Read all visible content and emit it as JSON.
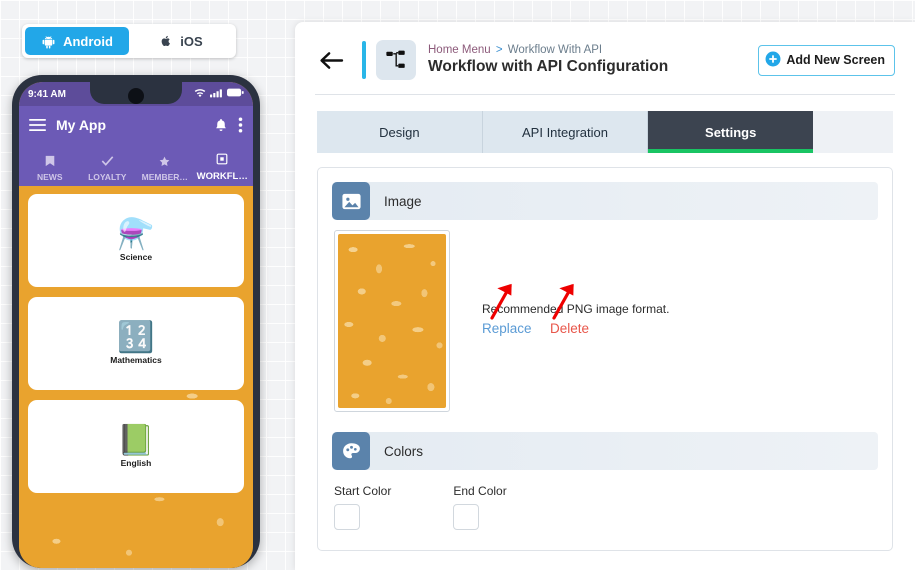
{
  "platform_switch": {
    "options": [
      {
        "label": "Android",
        "icon": "android-icon",
        "active": true
      },
      {
        "label": "iOS",
        "icon": "apple-icon",
        "active": false
      }
    ]
  },
  "phone": {
    "status_bar": {
      "time": "9:41 AM",
      "icons": [
        "wifi-icon",
        "cellular-signal-icon",
        "battery-icon"
      ]
    },
    "app_bar": {
      "menu_icon": "hamburger-menu-icon",
      "title": "My App",
      "notification_icon": "bell-icon",
      "overflow_icon": "more-vertical-icon"
    },
    "tabs": [
      {
        "label": "NEWS",
        "icon": "bookmark-icon",
        "active": false
      },
      {
        "label": "LOYALTY",
        "icon": "check-icon",
        "active": false
      },
      {
        "label": "MEMBER…",
        "icon": "star-icon",
        "active": false
      },
      {
        "label": "WORKFL…",
        "icon": "workflow-square-icon",
        "active": true
      }
    ],
    "cards": [
      {
        "label": "Science",
        "emoji": "⚗️"
      },
      {
        "label": "Mathematics",
        "emoji": "🔢"
      },
      {
        "label": "English",
        "emoji": "📗"
      }
    ],
    "background_color": "#e9a32e",
    "app_bar_color": "#6c5ab6"
  },
  "header": {
    "back_icon": "back-arrow-icon",
    "workflow_icon": "workflow-diagram-icon",
    "breadcrumb": {
      "parent": "Home Menu",
      "separator": ">",
      "current": "Workflow With API"
    },
    "title": "Workflow with API Configuration",
    "add_button": {
      "label": "Add New Screen",
      "icon": "plus-circle-icon"
    },
    "accent_color": "#29b6e8"
  },
  "tabs": [
    {
      "label": "Design",
      "active": false
    },
    {
      "label": "API Integration",
      "active": false
    },
    {
      "label": "Settings",
      "active": true
    }
  ],
  "tab_active_underline_color": "#19c463",
  "image_section": {
    "title": "Image",
    "icon": "image-icon",
    "thumbnail_alt": "education-doodle-pattern",
    "recommendation": "Recommended PNG image format.",
    "replace_label": "Replace",
    "delete_label": "Delete",
    "replace_color": "#5b9bd5",
    "delete_color": "#e8564a",
    "annotation_arrows": 2,
    "annotation_color": "#ee0000"
  },
  "colors_section": {
    "title": "Colors",
    "icon": "palette-icon",
    "fields": [
      {
        "label": "Start Color",
        "value": "#ffffff"
      },
      {
        "label": "End Color",
        "value": "#ffffff"
      }
    ]
  }
}
